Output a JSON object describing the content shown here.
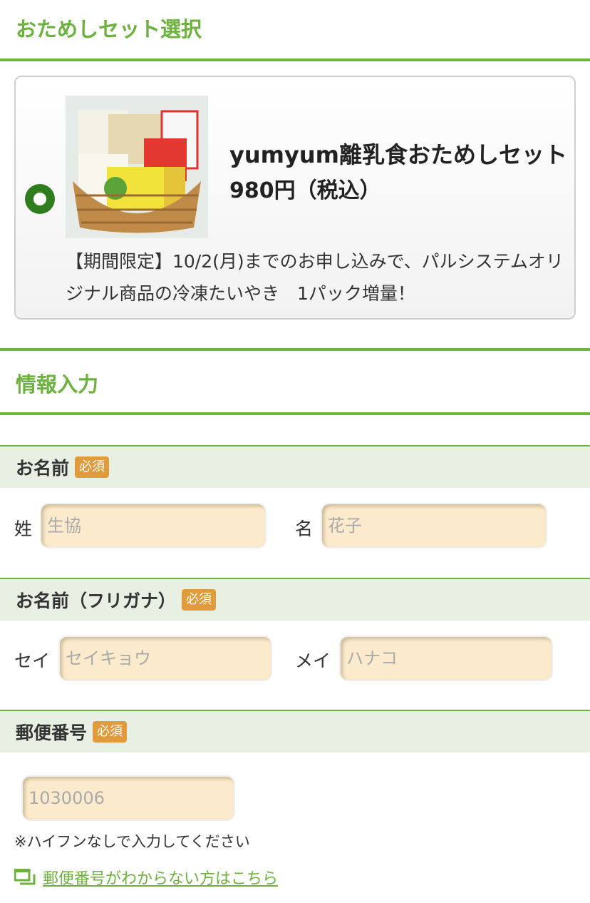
{
  "trial_set": {
    "section_title": "おためしセット選択",
    "product": {
      "name": "yumyum離乳食おためしセット",
      "price": "980円（税込）",
      "note": "【期間限定】10/2(月)までのお申し込みで、パルシステムオリジナル商品の冷凍たいやき　1パック増量！"
    }
  },
  "info_input": {
    "section_title": "情報入力",
    "name": {
      "label": "お名前",
      "required": "必須",
      "last_label": "姓",
      "last_placeholder": "生協",
      "first_label": "名",
      "first_placeholder": "花子"
    },
    "kana": {
      "label": "お名前（フリガナ）",
      "required": "必須",
      "last_label": "セイ",
      "last_placeholder": "セイキョウ",
      "first_label": "メイ",
      "first_placeholder": "ハナコ"
    },
    "postal": {
      "label": "郵便番号",
      "required": "必須",
      "placeholder": "1030006",
      "hint": "※ハイフンなしで入力してください",
      "help_link": "郵便番号がわからない方はこちら"
    }
  },
  "colors": {
    "accent_green": "#6cb23c",
    "radio_green": "#2f7d1f",
    "required_orange": "#e29b3c",
    "input_bg": "#fbeacb",
    "header_bg": "#e8f0e4"
  }
}
